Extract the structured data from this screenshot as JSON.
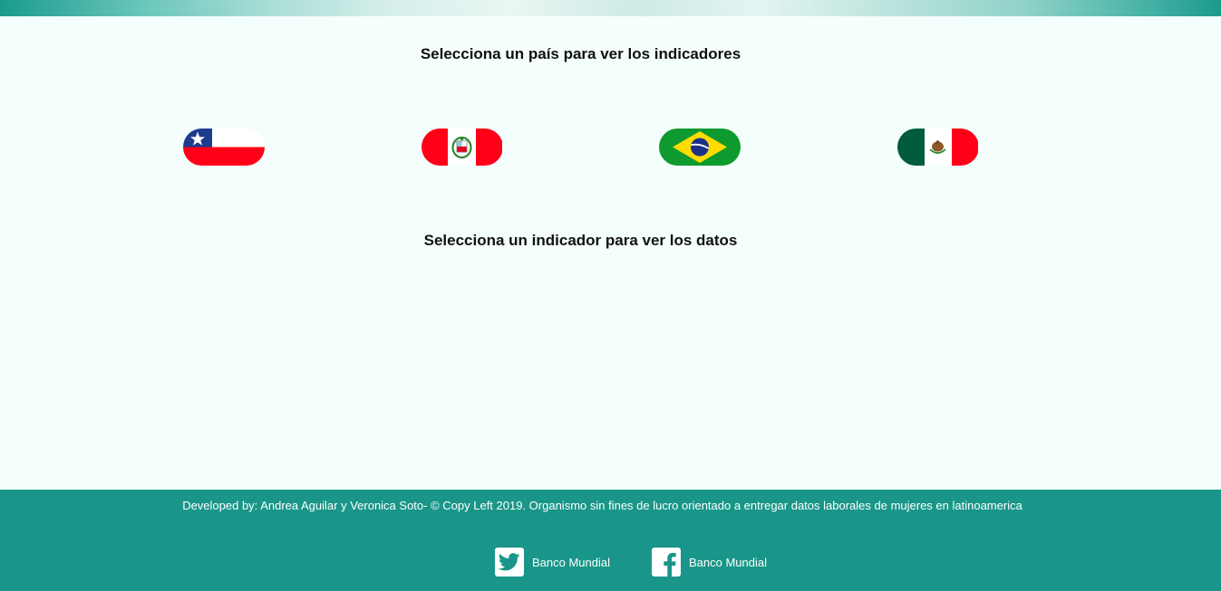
{
  "headings": {
    "country": "Selecciona un país para ver los indicadores",
    "indicator": "Selecciona un indicador para ver los datos"
  },
  "countries": [
    {
      "icon": "chile-flag-icon"
    },
    {
      "icon": "peru-flag-icon"
    },
    {
      "icon": "brazil-flag-icon"
    },
    {
      "icon": "mexico-flag-icon"
    }
  ],
  "footer": {
    "text": "Developed by: Andrea Aguilar y Veronica Soto- © Copy Left 2019. Organismo sin fines de lucro orientado a entregar datos laborales de mujeres en latinoamerica",
    "links": [
      {
        "icon": "twitter-icon",
        "label": "Banco Mundial"
      },
      {
        "icon": "facebook-icon",
        "label": "Banco Mundial"
      }
    ]
  },
  "colors": {
    "background": "#f4fffd",
    "footer": "#199689"
  }
}
